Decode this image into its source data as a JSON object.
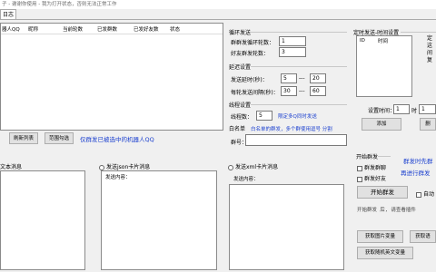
{
  "window": {
    "title_fragment": "子 - 谢谢你使用 - 我为打开状态，否则无法正常工作"
  },
  "tab": {
    "label": "日志"
  },
  "robot_table": {
    "columns": [
      "器人QQ",
      "昵称",
      "当前轮数",
      "已发群数",
      "已发好友数",
      "状态"
    ]
  },
  "robot_buttons": {
    "refresh": "刷新列表",
    "range_select": "范围勾选",
    "hint": "仅群发已被选中的机器人QQ"
  },
  "loop_send": {
    "title": "循环发送",
    "group_loops_label": "群群发循环轮数：",
    "group_loops_value": "1",
    "friend_loops_label": "好友群发轮数：",
    "friend_loops_value": "3"
  },
  "delay": {
    "title": "延迟设置",
    "send_delay_label": "发送延时(秒)：",
    "send_delay_from": "5",
    "send_delay_sep": "---",
    "send_delay_to": "20",
    "round_interval_label": "每轮发送间隔(秒)：",
    "round_interval_from": "30",
    "round_interval_sep": "---",
    "round_interval_to": "60"
  },
  "thread": {
    "title": "线程设置",
    "count_label": "线程数：",
    "count_value": "5",
    "hint": "限定多Q同时发送"
  },
  "whitelist": {
    "title": "白名单",
    "hint": "白名单的群发，多个群使用逗号 分割",
    "group_label": "群号："
  },
  "schedule": {
    "title": "定时发送-时间设置",
    "col_id": "ID",
    "col_time": "时间",
    "side_text": [
      "定",
      "这",
      "间",
      "复"
    ],
    "time_label": "设置时间：",
    "hour": "1",
    "hour_unit": "时",
    "minute": "1",
    "add_button": "添加",
    "delete_button": "删"
  },
  "send_text": {
    "label": "文本消息"
  },
  "send_json": {
    "label": "发送json卡片消息",
    "content_label": "发送内容："
  },
  "send_xml": {
    "label": "发送xml卡片消息",
    "content_label": "发送内容："
  },
  "start": {
    "title": "开始群发",
    "send_groups": "群发群聊",
    "send_friends": "群发好友",
    "notice1": "群发时先群",
    "notice2": "再进行群发",
    "start_button": "开始群发",
    "auto_label": "自动",
    "hint": "开始群发 后, 请查看插件"
  },
  "bottom_buttons": {
    "get_image": "获取图片变量",
    "get_link": "获取语",
    "get_random_text": "获取随机英文变量"
  }
}
